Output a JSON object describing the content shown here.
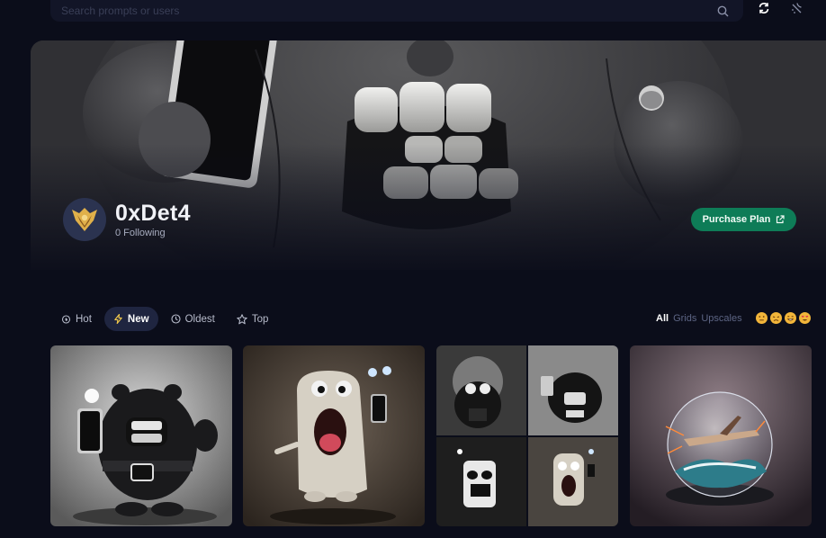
{
  "search": {
    "placeholder": "Search prompts or users"
  },
  "profile": {
    "username": "0xDet4",
    "following": "0 Following"
  },
  "banner": {
    "purchase_label": "Purchase Plan"
  },
  "sort_tabs": [
    {
      "label": "Hot",
      "icon": "flame-icon"
    },
    {
      "label": "New",
      "icon": "bolt-icon"
    },
    {
      "label": "Oldest",
      "icon": "clock-icon"
    },
    {
      "label": "Top",
      "icon": "star-icon"
    }
  ],
  "active_tab": "New",
  "type_filters": [
    "All",
    "Grids",
    "Upscales"
  ],
  "active_type_filter": "All",
  "reaction_filters": [
    "neutral-face",
    "weary-face",
    "grinning-face",
    "heart-eyes-face"
  ],
  "colors": {
    "background": "#0b0d1a",
    "accent_green": "#0e7c57",
    "active_tab_bg": "#1f2540"
  }
}
